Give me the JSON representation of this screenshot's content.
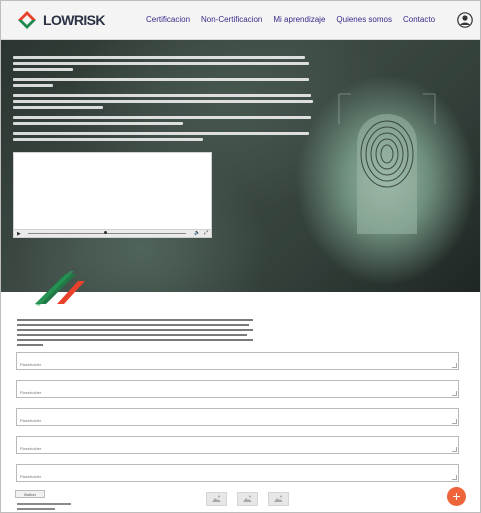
{
  "header": {
    "logo_text": "LOWRISK",
    "nav": [
      "Certificacion",
      "Non-Certificacion",
      "Mi aprendizaje",
      "Quienes somos",
      "Contacto"
    ],
    "user_icon": "user-circle-icon"
  },
  "hero": {
    "video": {
      "play_icon": "play-icon",
      "volume_icon": "volume-icon",
      "fullscreen_icon": "fullscreen-icon",
      "progress": 0.49
    },
    "image": "fingerprint-scan-icon"
  },
  "form": {
    "fields": [
      {
        "placeholder": "Placeholder"
      },
      {
        "placeholder": "Placeholder"
      },
      {
        "placeholder": "Placeholder"
      },
      {
        "placeholder": "Placeholder"
      },
      {
        "placeholder": "Placeholder"
      }
    ],
    "submit_label": "Button"
  },
  "thumbnails": [
    "image-icon",
    "image-icon",
    "image-icon"
  ],
  "fab": {
    "label": "+",
    "icon": "plus-icon"
  },
  "colors": {
    "brand_green": "#1f8a4c",
    "brand_red": "#e8412c",
    "nav_text": "#3b2a8a",
    "fab": "#f0643c"
  }
}
